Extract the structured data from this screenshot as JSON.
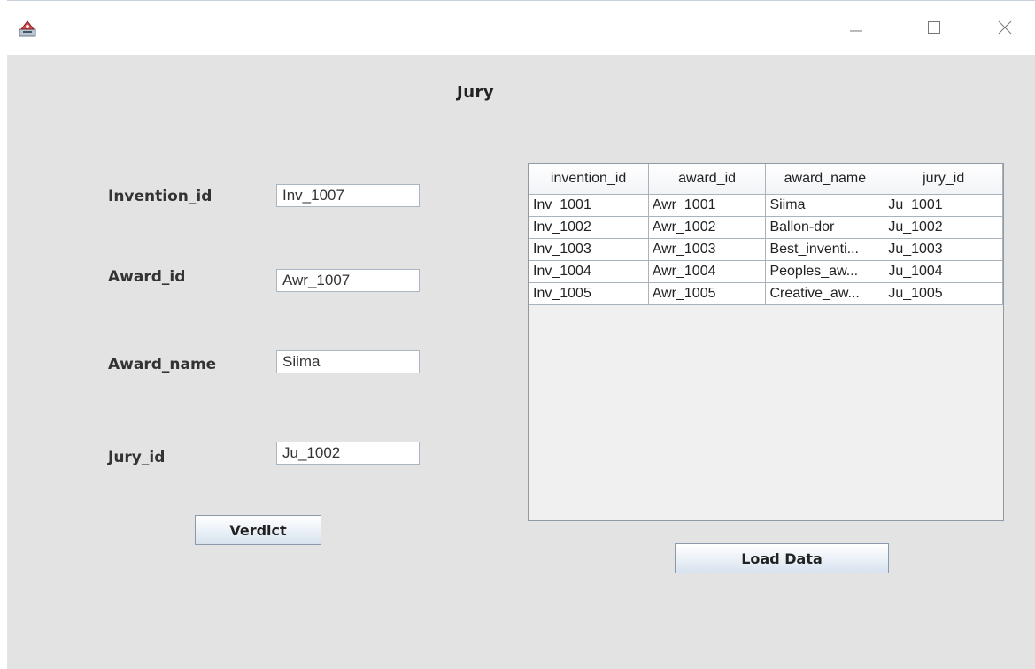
{
  "window": {
    "icons": {
      "app": "java-app-icon",
      "minimize": "minimize-icon",
      "maximize": "maximize-icon",
      "close": "close-icon"
    }
  },
  "form": {
    "title": "Jury",
    "invention_id": {
      "label": "Invention_id",
      "value": "Inv_1007"
    },
    "award_id": {
      "label": "Award_id",
      "value": "Awr_1007"
    },
    "award_name": {
      "label": "Award_name",
      "value": "Siima"
    },
    "jury_id": {
      "label": "Jury_id",
      "value": "Ju_1002"
    },
    "verdict_button": "Verdict"
  },
  "table": {
    "columns": [
      "invention_id",
      "award_id",
      "award_name",
      "jury_id"
    ],
    "rows": [
      [
        "Inv_1001",
        "Awr_1001",
        "Siima",
        "Ju_1001"
      ],
      [
        "Inv_1002",
        "Awr_1002",
        "Ballon-dor",
        "Ju_1002"
      ],
      [
        "Inv_1003",
        "Awr_1003",
        "Best_inventi...",
        "Ju_1003"
      ],
      [
        "Inv_1004",
        "Awr_1004",
        "Peoples_aw...",
        "Ju_1004"
      ],
      [
        "Inv_1005",
        "Awr_1005",
        "Creative_aw...",
        "Ju_1005"
      ]
    ]
  },
  "load_button": "Load Data"
}
